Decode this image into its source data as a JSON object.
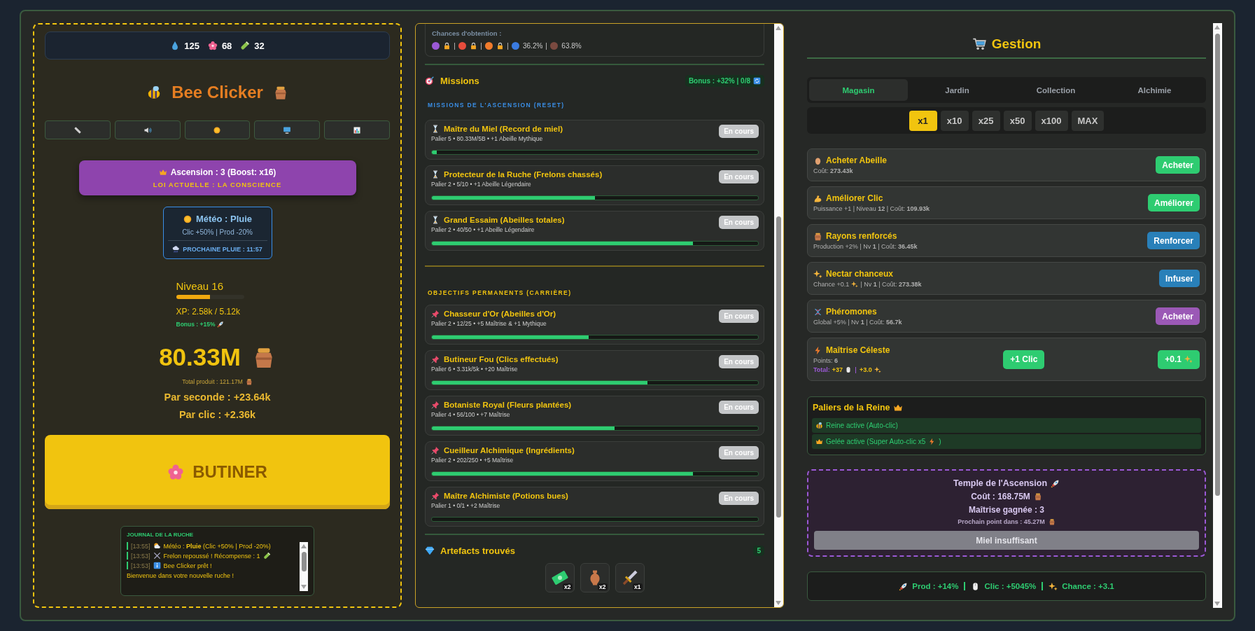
{
  "resources": [
    {
      "value": "125"
    },
    {
      "value": "68"
    },
    {
      "value": "32"
    }
  ],
  "title": "Bee Clicker",
  "ascension": {
    "title": "Ascension : 3 (Boost: x16)",
    "law": "LOI ACTUELLE : LA CONSCIENCE"
  },
  "weather": {
    "title": "Météo : Pluie",
    "effect": "Clic +50% | Prod -20%",
    "next": "PROCHAINE PLUIE : 11:57"
  },
  "level": {
    "label": "Niveau 16",
    "level": 0.5,
    "xp": "XP: 2.58k / 5.12k",
    "bonus": "Bonus : +15%"
  },
  "honey": {
    "amount": "80.33M",
    "total": "Total produit : 121.17M",
    "per_second": "Par seconde : +23.64k",
    "per_click": "Par clic : +2.36k"
  },
  "harvest_button": "BUTINER",
  "journal": {
    "title": "JOURNAL DE LA RUCHE",
    "entries": [
      {
        "time": "[13:55]",
        "text": "Météo : **Pluie** (Clic +50% | Prod -20%)"
      },
      {
        "time": "[13:53]",
        "text": "Frelon repoussé ! Récompense : 1"
      },
      {
        "time": "[13:53]",
        "text": "Bee Clicker prêt !"
      }
    ],
    "footer": "Bienvenue dans votre nouvelle ruche !"
  },
  "chances": {
    "label": "Chances d'obtention :",
    "items": [
      {
        "color": "#9b59d6",
        "locked": true
      },
      {
        "color": "#e74c3c",
        "locked": true
      },
      {
        "color": "#f07b2c",
        "locked": true
      },
      {
        "color": "#3a7be0",
        "locked": false,
        "value": "36.2%"
      },
      {
        "color": "#7a4a40",
        "locked": false,
        "value": "63.8%"
      }
    ]
  },
  "missions": {
    "title": "Missions",
    "bonus": "Bonus : +32% | 0/8",
    "ascension_heading": "MISSIONS DE L'ASCENSION (RESET)",
    "ascension": [
      {
        "name": "Maître du Miel (Record de miel)",
        "detail": "Palier 5 • 80.33M/5B • +1 Abeille Mythique",
        "status": "En cours",
        "level": 0.016
      },
      {
        "name": "Protecteur de la Ruche (Frelons chassés)",
        "detail": "Palier 2 • 5/10 • +1 Abeille Légendaire",
        "status": "En cours",
        "level": 0.5
      },
      {
        "name": "Grand Essaim (Abeilles totales)",
        "detail": "Palier 2 • 40/50 • +1 Abeille Légendaire",
        "status": "En cours",
        "level": 0.8
      }
    ],
    "career_heading": "OBJECTIFS PERMANENTS (CARRIÈRE)",
    "career": [
      {
        "name": "Chasseur d'Or (Abeilles d'Or)",
        "detail": "Palier 2 • 12/25 • +5 Maîtrise & +1 Mythique",
        "status": "En cours",
        "level": 0.48
      },
      {
        "name": "Butineur Fou (Clics effectués)",
        "detail": "Palier 6 • 3.31k/5k • +20 Maîtrise",
        "status": "En cours",
        "level": 0.66
      },
      {
        "name": "Botaniste Royal (Fleurs plantées)",
        "detail": "Palier 4 • 56/100 • +7 Maîtrise",
        "status": "En cours",
        "level": 0.56
      },
      {
        "name": "Cueilleur Alchimique (Ingrédients)",
        "detail": "Palier 2 • 202/250 • +5 Maîtrise",
        "status": "En cours",
        "level": 0.8
      },
      {
        "name": "Maître Alchimiste (Potions bues)",
        "detail": "Palier 1 • 0/1 • +2 Maîtrise",
        "status": "En cours",
        "level": 0
      }
    ]
  },
  "artefacts": {
    "title": "Artefacts trouvés",
    "count": "5",
    "items": [
      {
        "count": "x2"
      },
      {
        "count": "x2"
      },
      {
        "count": "x1"
      }
    ]
  },
  "gestion": {
    "title": "Gestion",
    "tabs": [
      {
        "label": "Magasin",
        "selected": true
      },
      {
        "label": "Jardin",
        "selected": false
      },
      {
        "label": "Collection",
        "selected": false
      },
      {
        "label": "Alchimie",
        "selected": false
      }
    ],
    "multipliers": [
      {
        "label": "x1",
        "selected": true
      },
      {
        "label": "x10",
        "selected": false
      },
      {
        "label": "x25",
        "selected": false
      },
      {
        "label": "x50",
        "selected": false
      },
      {
        "label": "x100",
        "selected": false
      },
      {
        "label": "MAX",
        "selected": false
      }
    ],
    "shop": [
      {
        "kind": "upgrade",
        "name": "Acheter Abeille",
        "detail": "Coût: **273.43k**",
        "button": "Acheter",
        "color": "#2ecc71"
      },
      {
        "kind": "upgrade",
        "name": "Améliorer Clic",
        "detail": "Puissance +1 | Niveau **12** | Coût: **109.93k**",
        "button": "Améliorer",
        "color": "#2ecc71"
      },
      {
        "kind": "upgrade",
        "name": "Rayons renforcés",
        "detail": "Production +2% | Nv **1** | Coût: **36.45k**",
        "button": "Renforcer",
        "color": "#2980b9"
      },
      {
        "kind": "upgrade",
        "name": "Nectar chanceux",
        "detail": "Chance +0.1",
        "detail_rest": "| Nv **1** | Coût: **273.38k**",
        "button": "Infuser",
        "color": "#2980b9"
      },
      {
        "kind": "upgrade",
        "name": "Phéromones",
        "detail": "Global +5% | Nv **1** | Coût: **56.7k**",
        "button": "Acheter",
        "color": "#9b59b6"
      },
      {
        "kind": "mastery",
        "name": "Maîtrise Céleste",
        "detail": "Points: **6**",
        "total_label": "Total:",
        "total_click": "+37",
        "total_chance": "+3.0",
        "buttons": [
          {
            "label": "+1 Clic",
            "color": "#2ecc71"
          },
          {
            "label": "+0.1",
            "color": "#2ecc71"
          }
        ]
      }
    ]
  },
  "queen": {
    "title": "Paliers de la Reine",
    "items": [
      {
        "text": "Reine active (Auto-clic)"
      },
      {
        "text": "Gelée active (Super Auto-clic x5",
        "text_after": ")"
      }
    ]
  },
  "temple": {
    "title": "Temple de l'Ascension",
    "cost": "Coût : 168.75M",
    "mastery": "Maîtrise gagnée : 3",
    "next": "Prochain point dans : 45.27M",
    "button": "Miel insuffisant",
    "disabled": true
  },
  "summary": [
    {
      "text": "Prod : +14%"
    },
    {
      "text": "Clic : +5045%"
    },
    {
      "text": "Chance : +3.1"
    }
  ]
}
